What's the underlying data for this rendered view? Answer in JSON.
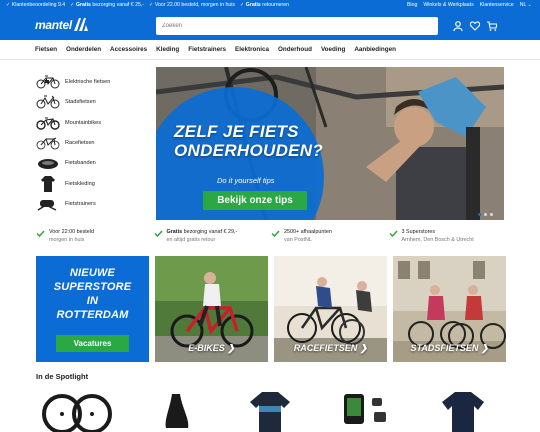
{
  "topbar": {
    "usps": [
      {
        "icon": "check-icon",
        "bold": "",
        "text": "Klantenbeoordeling 9.4"
      },
      {
        "icon": "check-icon",
        "bold": "Gratis",
        "text": " bezorging vanaf € 25,-"
      },
      {
        "icon": "check-icon",
        "bold": "",
        "text": "Voor 22.00 besteld, morgen in huis"
      },
      {
        "icon": "check-icon",
        "bold": "Gratis",
        "text": " retourneren"
      }
    ],
    "links": [
      "Blog",
      "Winkels & Werkplaats",
      "Klantenservice"
    ],
    "language": "NL"
  },
  "header": {
    "logo": "mantel",
    "search_placeholder": "Zoeken"
  },
  "nav": [
    "Fietsen",
    "Onderdelen",
    "Accessoires",
    "Kleding",
    "Fietstrainers",
    "Elektronica",
    "Onderhoud",
    "Voeding",
    "Aanbiedingen"
  ],
  "categories": [
    {
      "label": "Elektrische fietsen",
      "icon": "ebike-icon"
    },
    {
      "label": "Stadsfietsen",
      "icon": "citybike-icon"
    },
    {
      "label": "Mountainbikes",
      "icon": "mountainbike-icon"
    },
    {
      "label": "Racefietsen",
      "icon": "racebike-icon"
    },
    {
      "label": "Fietsbanden",
      "icon": "tire-icon"
    },
    {
      "label": "Fietskleding",
      "icon": "jersey-icon"
    },
    {
      "label": "Fietstrainers",
      "icon": "trainer-icon"
    }
  ],
  "hero": {
    "title_line1": "ZELF JE FIETS",
    "title_line2": "ONDERHOUDEN?",
    "subtitle": "Do it yourself tips",
    "button": "Bekijk onze tips",
    "slides": 3,
    "active_slide": 1
  },
  "usps": [
    {
      "line1": "Voor 22:00 besteld",
      "line2": "morgen in huis",
      "bold": ""
    },
    {
      "line1": " bezorging vanaf € 29,-",
      "line2": "en altijd gratis retour",
      "bold": "Gratis"
    },
    {
      "line1": "2500+ afhaalpunten",
      "line2": "van PostNL",
      "bold": ""
    },
    {
      "line1": "3 Superstores",
      "line2": "Arnhem, Den Bosch & Utrecht",
      "bold": ""
    }
  ],
  "promo": {
    "line1": "NIEUWE",
    "line2": "SUPERSTORE",
    "line3": "IN",
    "line4": "ROTTERDAM",
    "button": "Vacatures"
  },
  "tiles": [
    {
      "label": "E-BIKES ❯"
    },
    {
      "label": "RACEFIETSEN ❯"
    },
    {
      "label": "STADSFIETSEN ❯"
    }
  ],
  "spotlight": {
    "title": "In de Spotlight",
    "items": [
      "wheelset-icon",
      "saddle-icon",
      "jersey-icon",
      "bike-computer-icon",
      "jacket-icon"
    ]
  },
  "colors": {
    "brand": "#0a6cd4",
    "cta": "#2aa844",
    "check": "#2aa844"
  }
}
